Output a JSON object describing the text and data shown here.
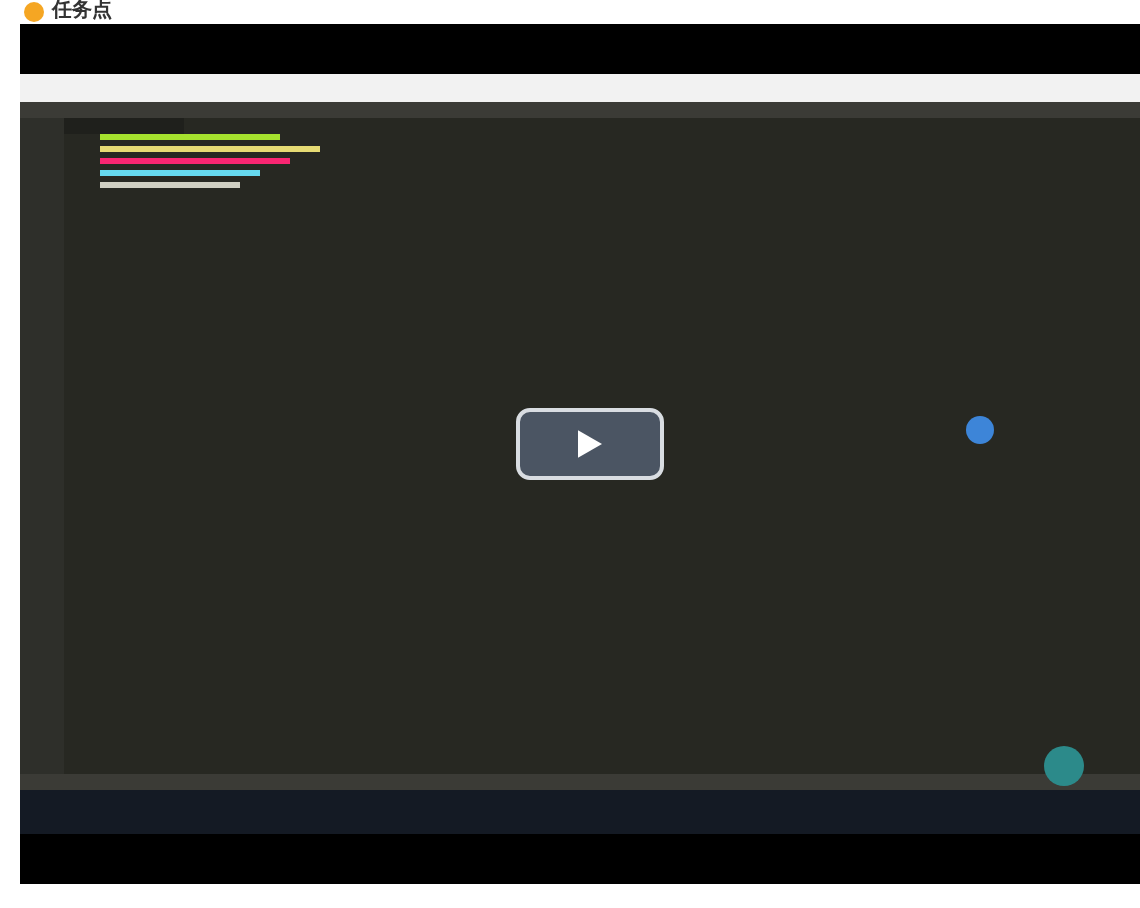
{
  "header": {
    "label": "任务点"
  },
  "player": {
    "paused": true
  }
}
